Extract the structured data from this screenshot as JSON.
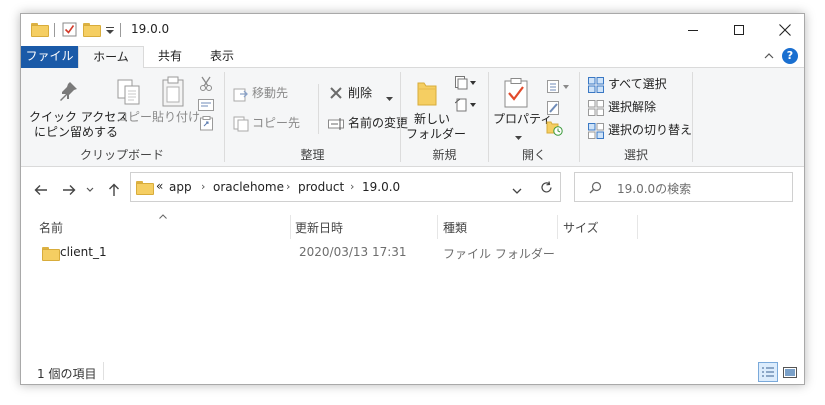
{
  "window": {
    "title": "19.0.0"
  },
  "ribbon_tabs": {
    "file": "ファイル",
    "home": "ホーム",
    "share": "共有",
    "view": "表示"
  },
  "clipboard": {
    "pin_line1": "クイック アクセス",
    "pin_line2": "にピン留めする",
    "copy": "コピー",
    "paste": "貼り付け",
    "group": "クリップボード"
  },
  "organize": {
    "move_to": "移動先",
    "copy_to": "コピー先",
    "delete": "削除",
    "rename": "名前の変更",
    "group": "整理"
  },
  "new": {
    "new_folder_line1": "新しい",
    "new_folder_line2": "フォルダー",
    "group": "新規"
  },
  "open": {
    "properties": "プロパティ",
    "group": "開く"
  },
  "select": {
    "select_all": "すべて選択",
    "select_none": "選択解除",
    "invert": "選択の切り替え",
    "group": "選択"
  },
  "address": {
    "overflow": "«",
    "crumbs": [
      "app",
      "oraclehome",
      "product",
      "19.0.0"
    ]
  },
  "search": {
    "placeholder": "19.0.0の検索"
  },
  "columns": {
    "name": "名前",
    "modified": "更新日時",
    "type": "種類",
    "size": "サイズ"
  },
  "files": [
    {
      "name": "client_1",
      "modified": "2020/03/13 17:31",
      "type": "ファイル フォルダー",
      "size": ""
    }
  ],
  "status": {
    "count": "1 個の項目"
  },
  "colors": {
    "file_tab": "#1a5aa8",
    "ribbon_bg": "#f5f6f7",
    "folder": "#f5ce62",
    "accent_blue": "#1a6fd0"
  }
}
